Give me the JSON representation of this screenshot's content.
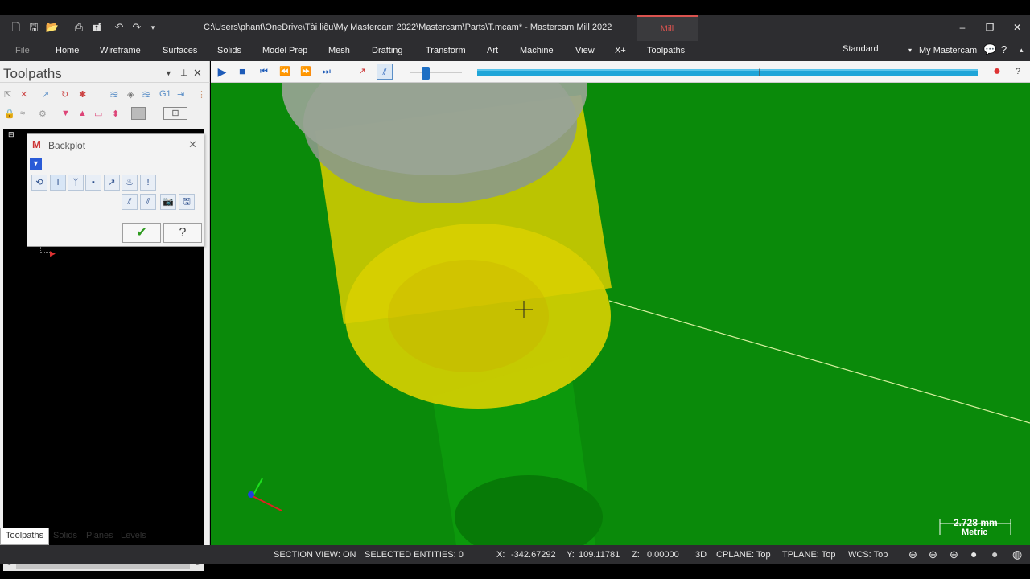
{
  "window": {
    "title": "C:\\Users\\phant\\OneDrive\\Tài liệu\\My Mastercam 2022\\Mastercam\\Parts\\T.mcam* - Mastercam Mill 2022",
    "context_tab": "Mill",
    "workspace": "Standard",
    "my_mastercam": "My Mastercam"
  },
  "ribbon": {
    "tabs": [
      "File",
      "Home",
      "Wireframe",
      "Surfaces",
      "Solids",
      "Model Prep",
      "Mesh",
      "Drafting",
      "Transform",
      "Art",
      "Machine",
      "View",
      "X+",
      "Toolpaths"
    ]
  },
  "panel": {
    "title": "Toolpaths",
    "bottom_tabs": [
      "Toolpaths",
      "Solids",
      "Planes",
      "Levels"
    ]
  },
  "backplot": {
    "title": "Backplot"
  },
  "viewport": {
    "scale_value": "2.728 mm",
    "scale_unit": "Metric",
    "colors": {
      "background": "#0a8a0a",
      "tool_yellow": "#d9d000",
      "holder_gray": "#8a9a86"
    }
  },
  "status": {
    "section_view": "SECTION VIEW: ON",
    "selected": "SELECTED ENTITIES: 0",
    "x_label": "X:",
    "x_value": "-342.67292",
    "y_label": "Y:",
    "y_value": "109.11781",
    "z_label": "Z:",
    "z_value": "0.00000",
    "mode": "3D",
    "cplane": "CPLANE: Top",
    "tplane": "TPLANE: Top",
    "wcs": "WCS: Top"
  }
}
